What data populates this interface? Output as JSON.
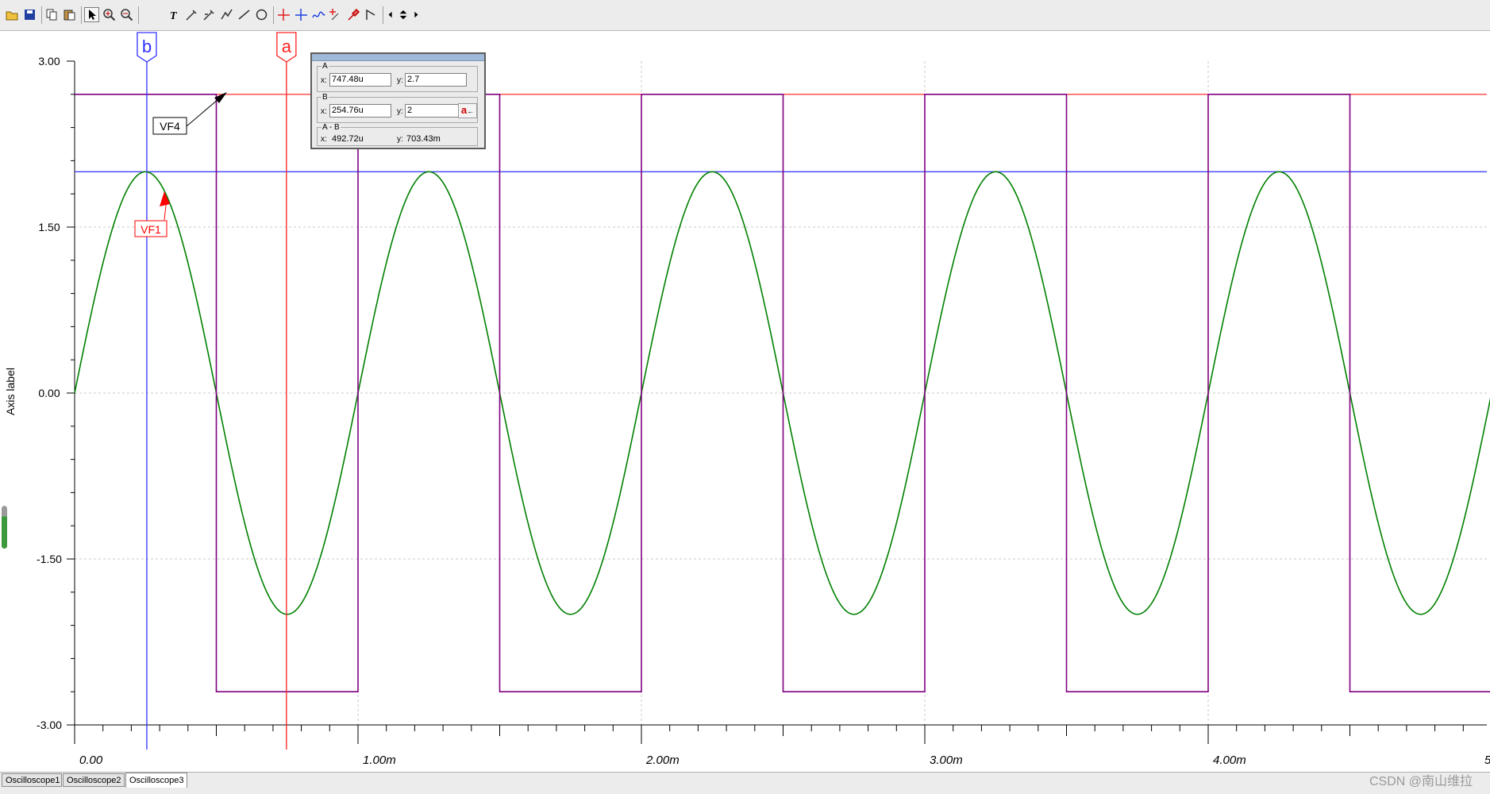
{
  "toolbar": {
    "buttons": [
      "open-icon",
      "save-icon",
      "copy-icon",
      "paste-icon",
      "pointer-icon",
      "zoom-in-icon",
      "zoom-out-icon",
      "text-tool-icon",
      "probe-icon",
      "probe-alt-icon",
      "chart-icon",
      "line-tool-icon",
      "circle-tool-icon",
      "cursor-a-icon",
      "cursor-b-icon",
      "signal-icon",
      "add-marker-icon",
      "pin-icon",
      "flag-icon",
      "scroll-left-icon",
      "scroll-updown-icon",
      "scroll-right-icon"
    ]
  },
  "chart_data": {
    "type": "line",
    "ylabel": "Axis label",
    "xlabel": "",
    "xlim": [
      0,
      0.005
    ],
    "ylim": [
      -3,
      3
    ],
    "x_ticks": [
      "0.00",
      "1.00m",
      "2.00m",
      "3.00m",
      "4.00m",
      "5"
    ],
    "y_ticks": [
      "3.00",
      "1.50",
      "0.00",
      "-1.50",
      "-3.00"
    ],
    "grid": true,
    "series": [
      {
        "color": "#008000",
        "kind": "sine",
        "amplitude": 2,
        "period_s": 0.001,
        "phase": "sin"
      },
      {
        "color": "#800080",
        "kind": "square",
        "high": 2.7,
        "low": -2.7,
        "period_s": 0.001,
        "duty": 0.5,
        "start": "high"
      }
    ],
    "reference_lines": [
      {
        "y": 2.7,
        "color": "#ff4040"
      },
      {
        "y": 2,
        "color": "#4040ff"
      }
    ],
    "cursors": [
      {
        "label": "a",
        "x": 0.00074748,
        "color": "#ff2020"
      },
      {
        "label": "b",
        "x": 0.00025476,
        "color": "#3030ff"
      }
    ],
    "markers": [
      {
        "label": "VF4",
        "color": "#000000"
      },
      {
        "label": "VF1",
        "color": "#ff0000"
      }
    ]
  },
  "cursor_panel": {
    "a_title": "A",
    "a_x_label": "x:",
    "a_x": "747.48u",
    "a_y_label": "y:",
    "a_y": "2.7",
    "b_title": "B",
    "b_x_label": "x:",
    "b_x": "254.76u",
    "b_y_label": "y:",
    "b_y": "2",
    "set_button": "a",
    "diff_title": "A - B",
    "d_x_label": "x:",
    "d_x": "492.72u",
    "d_y_label": "y:",
    "d_y": "703.43m"
  },
  "tabs": [
    "Oscilloscope1",
    "Oscilloscope2",
    "Oscilloscope3"
  ],
  "active_tab": 2,
  "watermark": "CSDN @南山维拉"
}
